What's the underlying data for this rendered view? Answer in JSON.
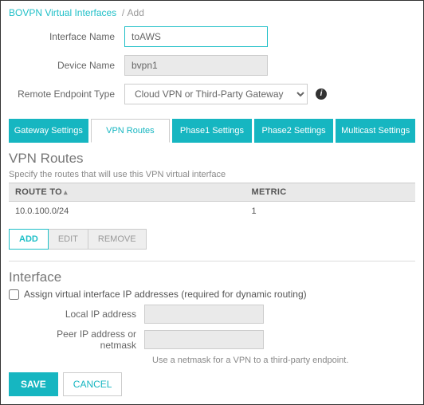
{
  "breadcrumb": {
    "parent": "BOVPN Virtual Interfaces",
    "current": "Add"
  },
  "form": {
    "interfaceNameLabel": "Interface Name",
    "interfaceNameValue": "toAWS",
    "deviceNameLabel": "Device Name",
    "deviceNameValue": "bvpn1",
    "remoteEndpointLabel": "Remote Endpoint Type",
    "remoteEndpointValue": "Cloud VPN or Third-Party Gateway"
  },
  "tabs": {
    "gateway": "Gateway Settings",
    "vpnroutes": "VPN Routes",
    "phase1": "Phase1 Settings",
    "phase2": "Phase2 Settings",
    "multicast": "Multicast Settings"
  },
  "routes": {
    "title": "VPN Routes",
    "subtitle": "Specify the routes that will use this VPN virtual interface",
    "headers": {
      "routeTo": "ROUTE TO",
      "metric": "METRIC"
    },
    "rows": [
      {
        "routeTo": "10.0.100.0/24",
        "metric": "1"
      }
    ],
    "buttons": {
      "add": "ADD",
      "edit": "EDIT",
      "remove": "REMOVE"
    }
  },
  "interface": {
    "title": "Interface",
    "assignLabel": "Assign virtual interface IP addresses (required for dynamic routing)",
    "localLabel": "Local IP address",
    "localValue": "",
    "peerLabel": "Peer IP address or netmask",
    "peerValue": "",
    "hint": "Use a netmask for a VPN to a third-party endpoint."
  },
  "footer": {
    "save": "SAVE",
    "cancel": "CANCEL"
  }
}
